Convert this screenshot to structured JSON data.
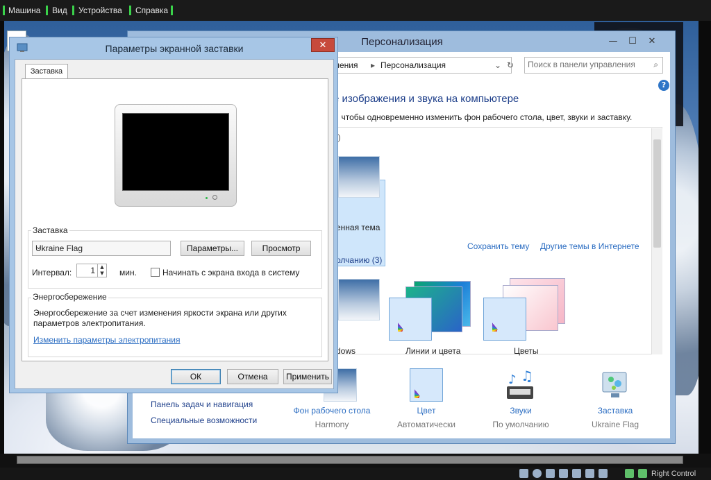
{
  "host": {
    "menu": [
      "Машина",
      "Вид",
      "Устройства",
      "Справка"
    ],
    "host_key": "Right Control"
  },
  "personalization": {
    "title": "Персонализация",
    "breadcrumb": [
      "ления",
      "Персонализация"
    ],
    "search_placeholder": "Поиск в панели управления",
    "heading": "е изображения и звука на компьютере",
    "subheading": "у, чтобы одновременно изменить фон рабочего стола, цвет, звуки и заставку.",
    "my_themes_count": "1)",
    "selected_theme_label": "енная тема",
    "save_theme": "Сохранить тему",
    "online_themes": "Другие темы в Интернете",
    "default_themes": "олчанию (3)",
    "themes": [
      {
        "label": "dows"
      },
      {
        "label": "Линии и цвета"
      },
      {
        "label": "Цветы"
      }
    ],
    "bottom": [
      {
        "label": "Фон рабочего стола",
        "sub": "Harmony"
      },
      {
        "label": "Цвет",
        "sub": "Автоматически"
      },
      {
        "label": "Звуки",
        "sub": "По умолчанию"
      },
      {
        "label": "Заставка",
        "sub": "Ukraine Flag"
      }
    ],
    "left_links": [
      "Панель задач и навигация",
      "Специальные возможности"
    ],
    "help": "?"
  },
  "dialog": {
    "title": "Параметры экранной заставки",
    "tab": "Заставка",
    "saver_group": "Заставка",
    "saver_selected": "Ukraine Flag",
    "settings_btn": "Параметры...",
    "preview_btn": "Просмотр",
    "interval_label": "Интервал:",
    "interval_value": "1",
    "minutes": "мин.",
    "resume_label": "Начинать с экрана входа в систему",
    "power_group": "Энергосбережение",
    "power_text_1": "Энергосбережение за счет изменения яркости экрана или других",
    "power_text_2": "параметров электропитания.",
    "power_link": "Изменить параметры электропитания",
    "ok": "ОК",
    "cancel": "Отмена",
    "apply": "Применить"
  }
}
